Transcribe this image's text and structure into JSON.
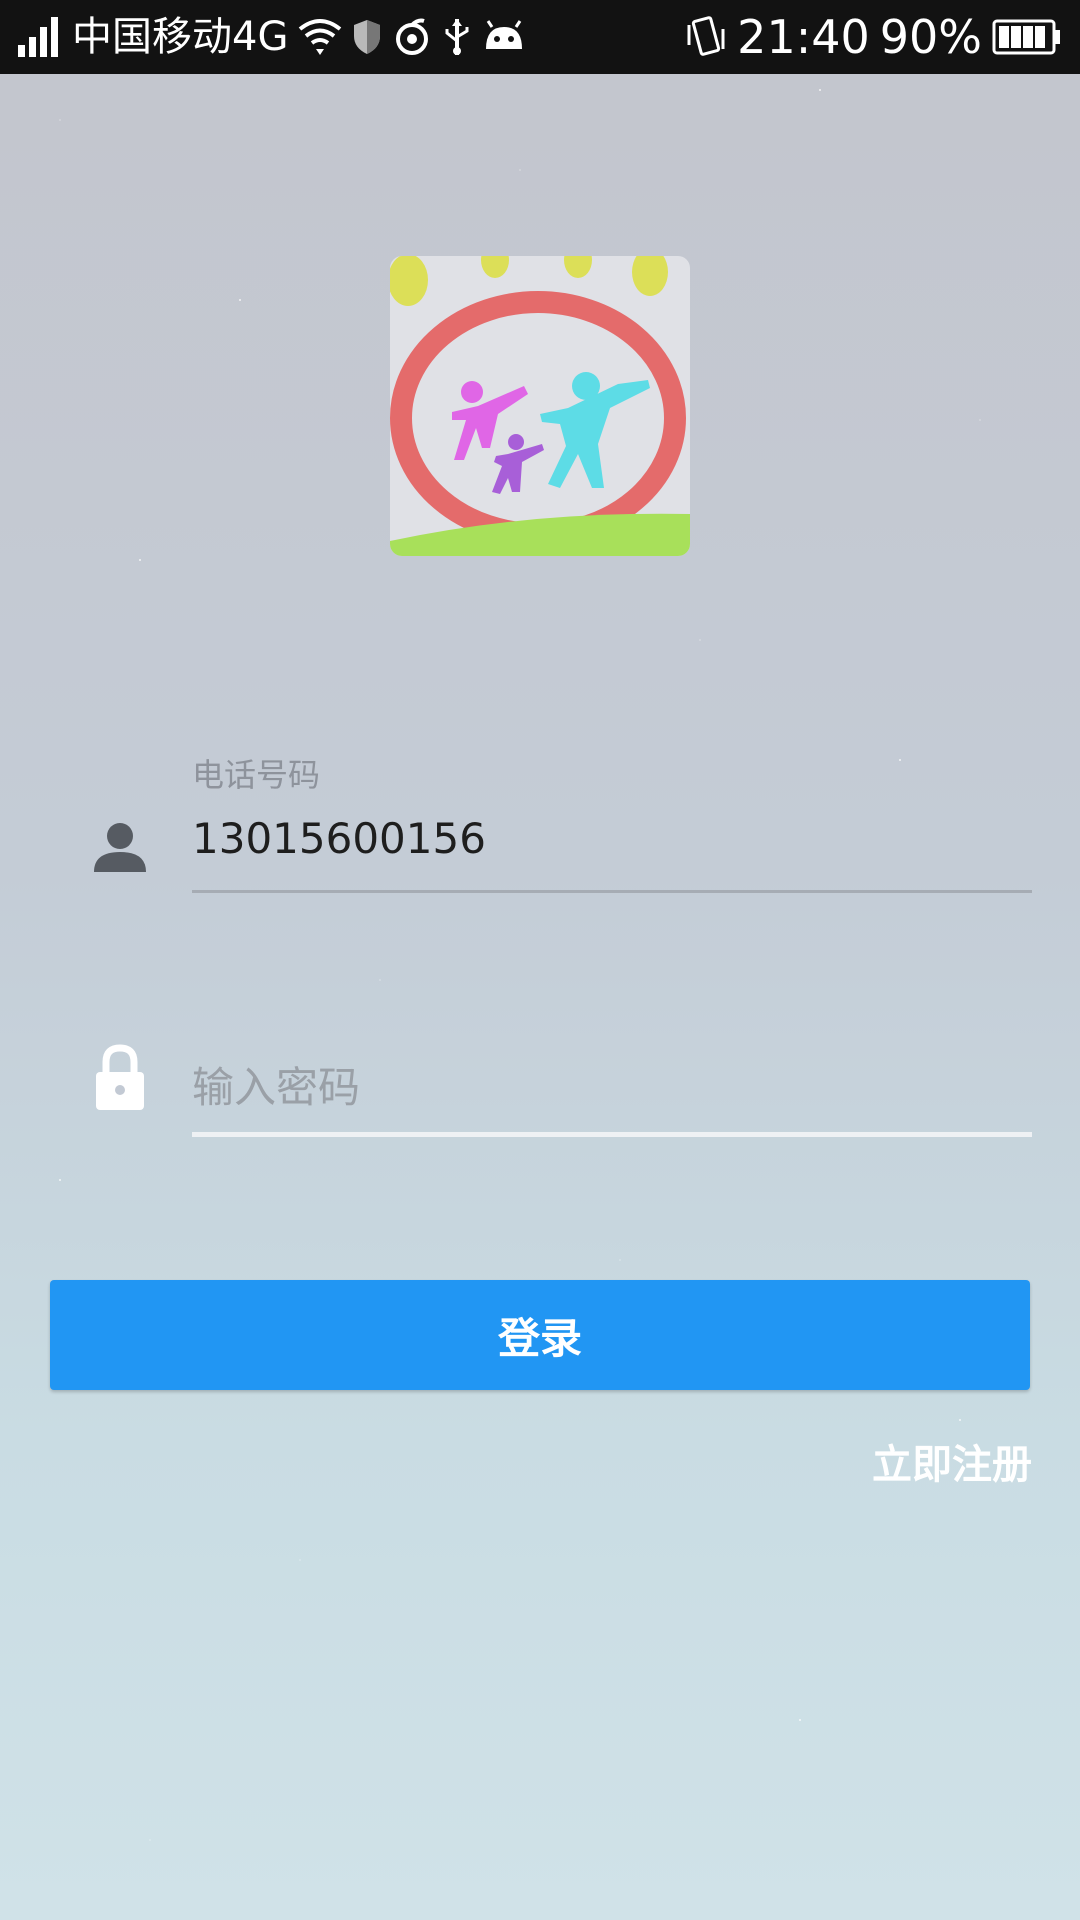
{
  "status_bar": {
    "carrier": "中国移动4G",
    "time": "21:40",
    "battery": "90%",
    "icons": [
      "signal-icon",
      "wifi-icon",
      "shield-icon",
      "netease-icon",
      "usb-icon",
      "android-icon",
      "vibrate-icon",
      "battery-icon"
    ]
  },
  "logo": {
    "name": "family-logo"
  },
  "form": {
    "phone": {
      "label": "电话号码",
      "value": "13015600156",
      "icon": "person-icon"
    },
    "password": {
      "placeholder": "输入密码",
      "icon": "lock-icon"
    }
  },
  "actions": {
    "login_label": "登录",
    "register_label": "立即注册"
  },
  "colors": {
    "primary": "#2196f3",
    "status_bar": "#121212"
  }
}
